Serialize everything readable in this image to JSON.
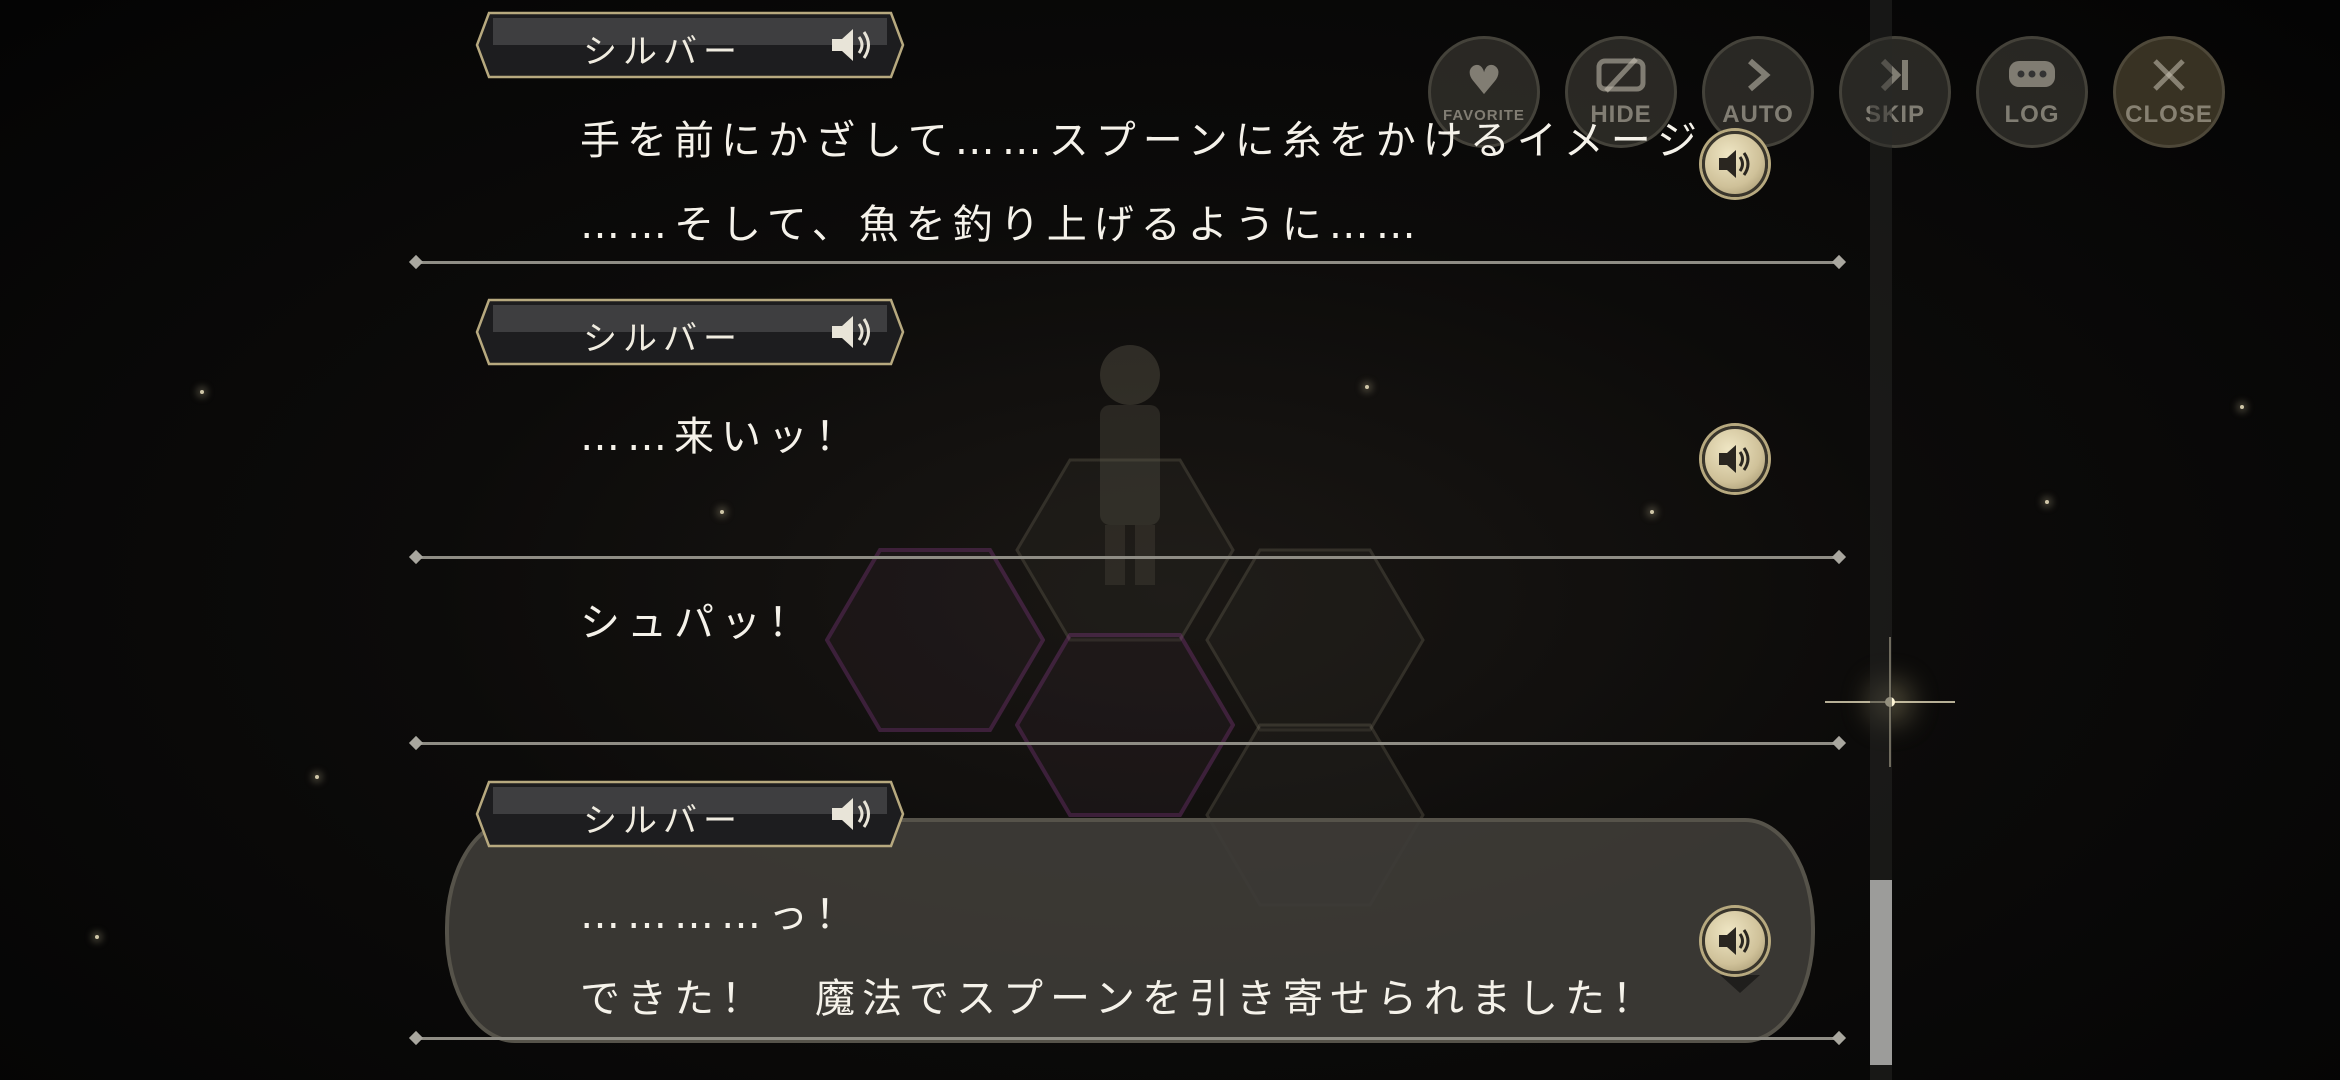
{
  "toolbar": {
    "favorite": {
      "label": "FAVORITE",
      "icon": "heart-icon"
    },
    "hide": {
      "label": "HIDE",
      "icon": "hide-icon"
    },
    "auto": {
      "label": "AUTO",
      "icon": "play-icon"
    },
    "skip": {
      "label": "SKIP",
      "icon": "skip-icon"
    },
    "log": {
      "label": "LOG",
      "icon": "chat-icon"
    },
    "close": {
      "label": "CLOSE",
      "icon": "close-icon"
    }
  },
  "log": {
    "entries": [
      {
        "speaker": "シルバー",
        "lines": [
          "手を前にかざして……スプーンに糸をかけるイメージ",
          "……そして、魚を釣り上げるように……"
        ]
      },
      {
        "speaker": "シルバー",
        "lines": [
          "……来いッ！"
        ]
      },
      {
        "speaker": "",
        "lines": [
          "シュパッ！"
        ]
      },
      {
        "speaker": "シルバー",
        "lines": [
          "…………っ！",
          "できた！　魔法でスプーンを引き寄せられました！"
        ]
      }
    ]
  },
  "colors": {
    "accent": "#cfc199",
    "text": "#f5f2ea",
    "divider": "#8f8d85"
  }
}
